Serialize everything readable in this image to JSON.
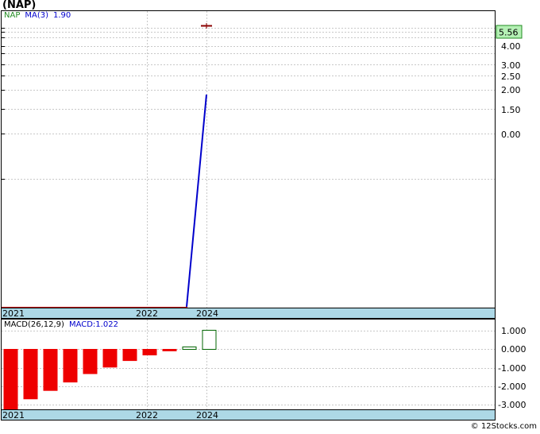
{
  "ticker_title": "(NAP)",
  "credit": "© 12Stocks.com",
  "colors": {
    "price": "#228b22",
    "ma": "#0000cc",
    "baseline": "#cc0000",
    "axis_bar": "#add8e6",
    "last_price_bg": "#b4f0b4",
    "macd_negative": "#ee0000",
    "macd_positive": "#006400"
  },
  "chart_data": [
    {
      "type": "line",
      "legend": {
        "price_label": "NAP",
        "ma_label": "MA(3)",
        "ma_value": "1.90"
      },
      "last_price": "5.56",
      "y_tick_labels": [
        "4.00",
        "3.00",
        "2.50",
        "2.00",
        "1.50",
        "0.00"
      ],
      "x_tick_labels": [
        "2021",
        "2022",
        "2024"
      ],
      "ma_line": [
        {
          "x": "2023-05",
          "y": 0.0
        },
        {
          "x": "2024-01",
          "y": 1.9
        }
      ],
      "price_bar": {
        "x": "2024-01",
        "value": 5.56
      }
    },
    {
      "type": "bar",
      "legend": {
        "label": "MACD(26,12,9)",
        "value_label": "MACD:1.022"
      },
      "y_tick_labels": [
        "1.000",
        "0.000",
        "-1.000",
        "-2.000",
        "-3.000"
      ],
      "x_tick_labels": [
        "2021",
        "2022",
        "2024"
      ],
      "ylim": [
        -3.3,
        1.1
      ],
      "values": [
        -3.2,
        -2.65,
        -2.2,
        -1.75,
        -1.3,
        -0.95,
        -0.6,
        -0.3,
        -0.08,
        0.13,
        1.022
      ]
    }
  ]
}
